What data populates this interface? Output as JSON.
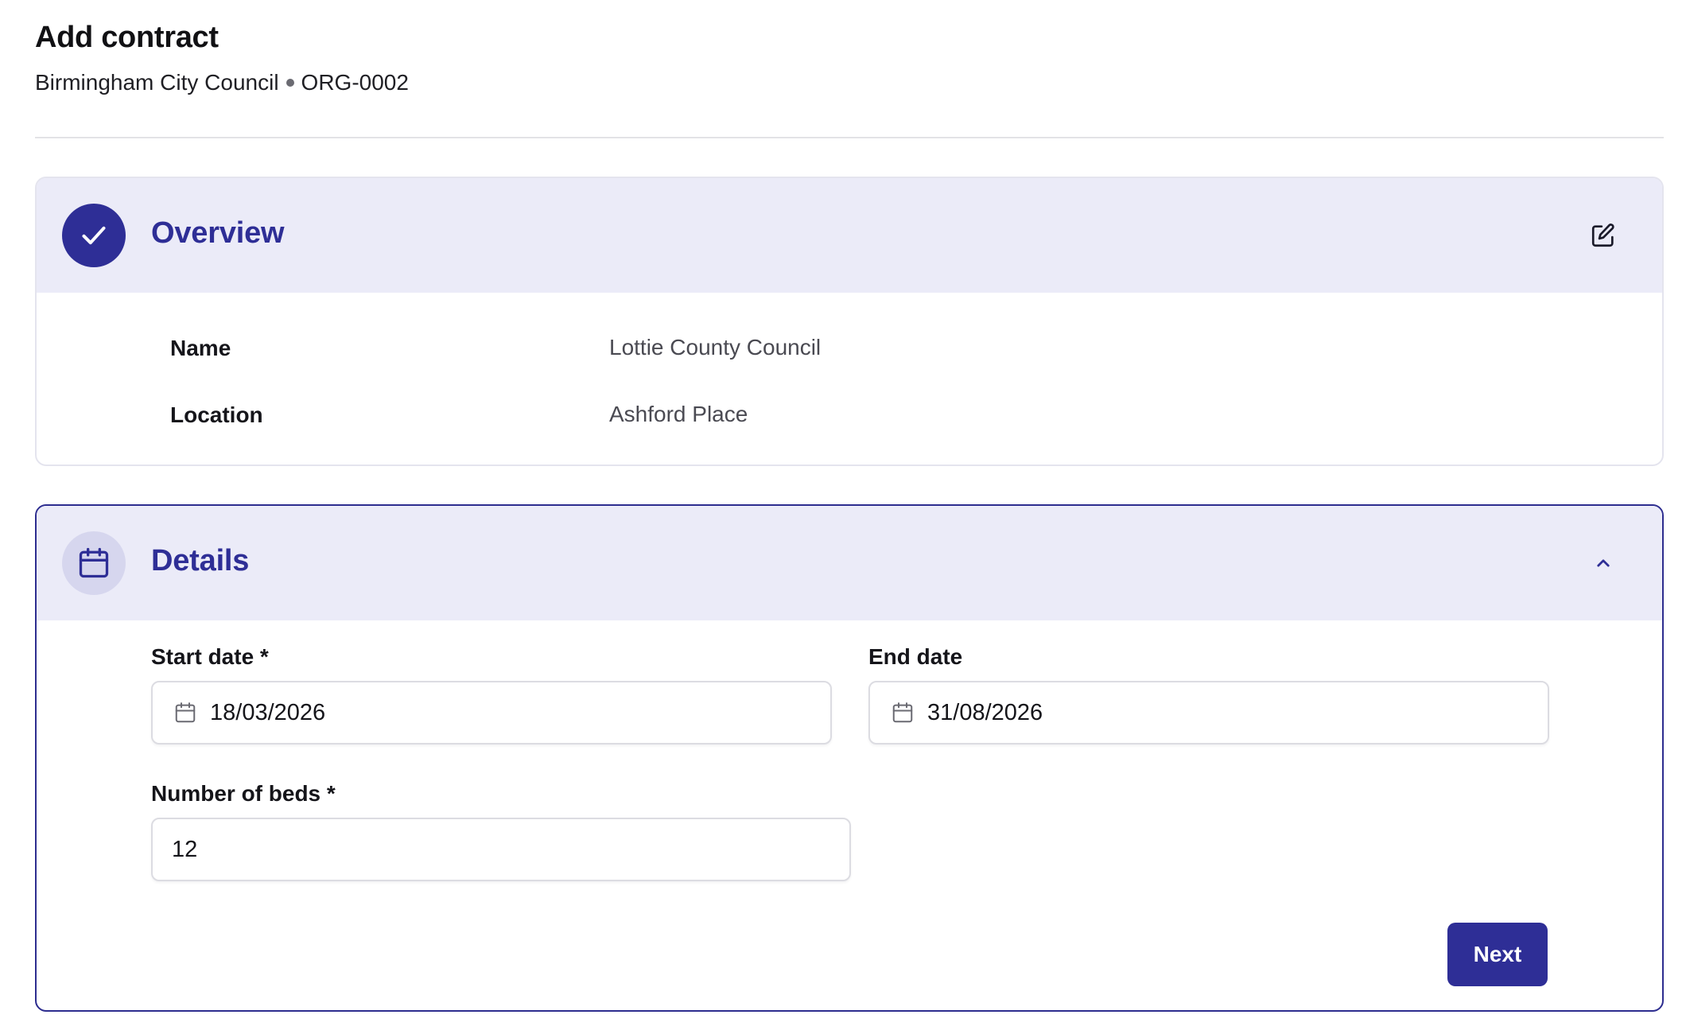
{
  "page": {
    "title": "Add contract",
    "organization": "Birmingham City Council",
    "organization_id": "ORG-0002"
  },
  "overview": {
    "title": "Overview",
    "status_icon": "check-icon",
    "edit_icon": "edit-icon",
    "rows": [
      {
        "label": "Name",
        "value": "Lottie County Council"
      },
      {
        "label": "Location",
        "value": "Ashford Place"
      }
    ]
  },
  "details": {
    "title": "Details",
    "step_icon": "calendar-icon",
    "collapse_icon": "chevron-up-icon",
    "start_date": {
      "label": "Start date *",
      "value": "18/03/2026"
    },
    "end_date": {
      "label": "End date",
      "value": "31/08/2026"
    },
    "beds": {
      "label": "Number of beds *",
      "value": "12"
    },
    "next_label": "Next"
  },
  "colors": {
    "accent": "#2e2e96",
    "header_bg": "#ebebf8",
    "border": "#dcdce2"
  }
}
